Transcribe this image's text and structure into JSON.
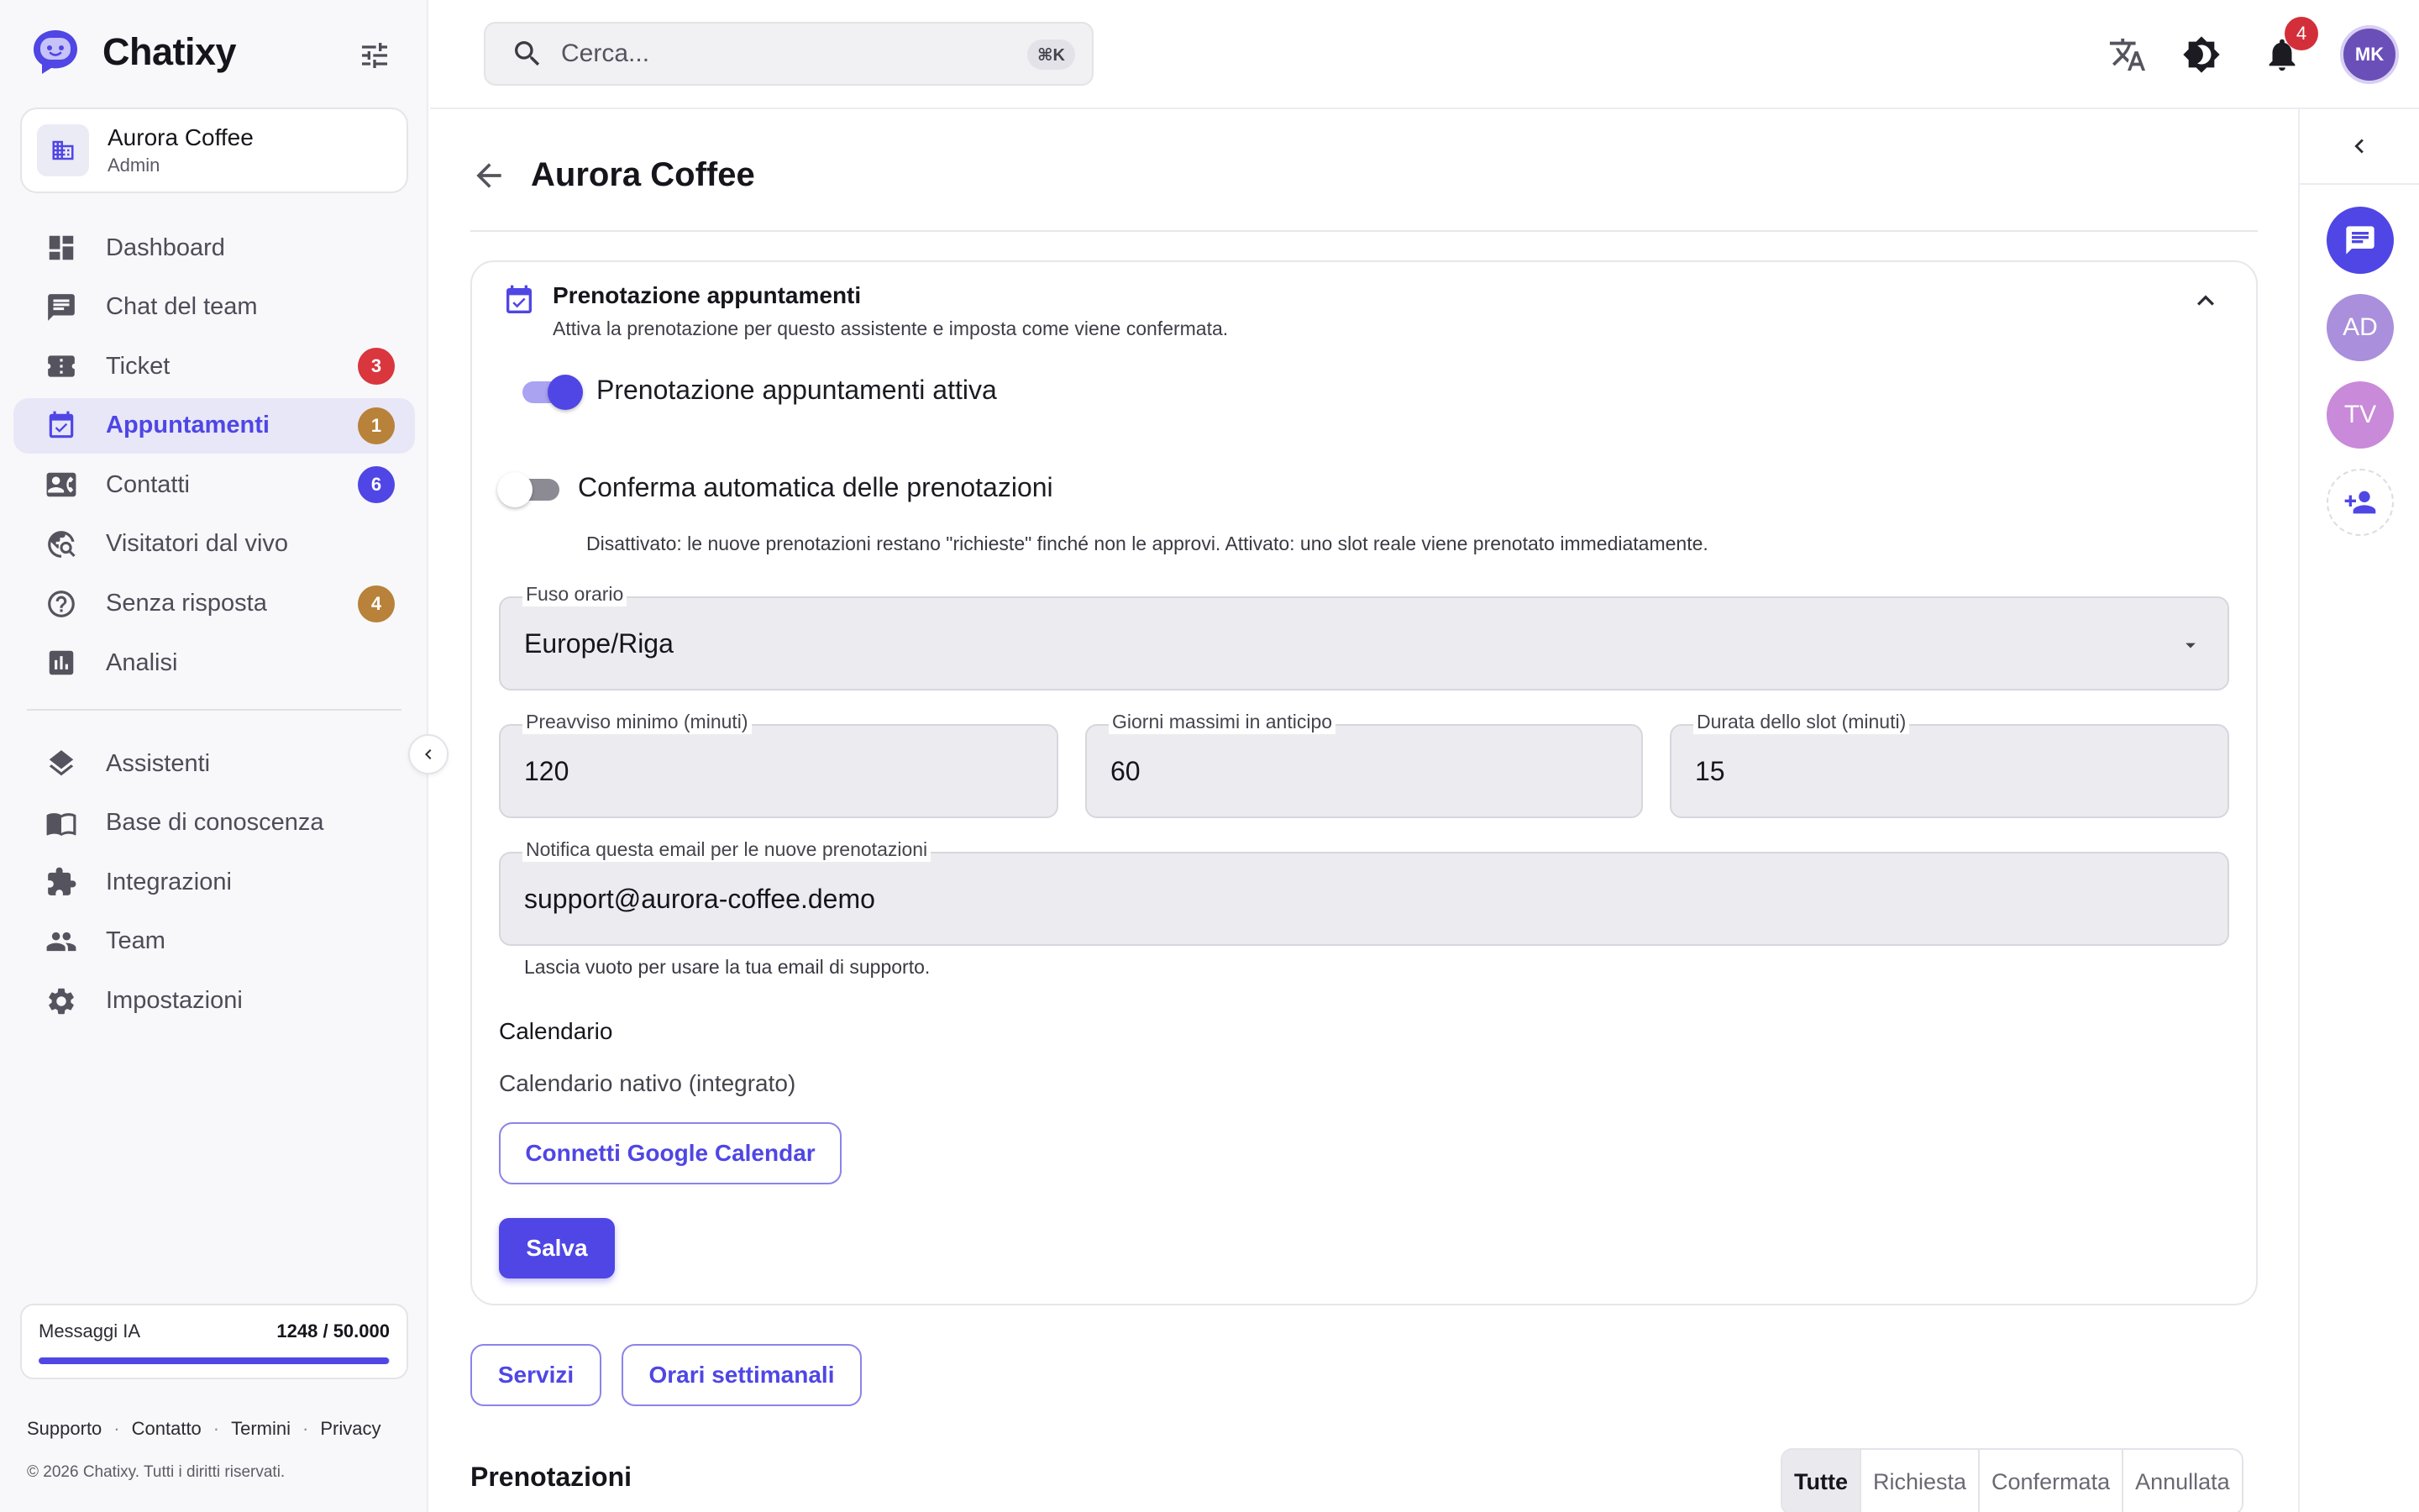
{
  "app": {
    "name": "Chatixy"
  },
  "workspace": {
    "name": "Aurora Coffee",
    "role": "Admin"
  },
  "nav": {
    "main": [
      {
        "label": "Dashboard",
        "icon": "dashboard-icon"
      },
      {
        "label": "Chat del team",
        "icon": "chat-icon"
      },
      {
        "label": "Ticket",
        "icon": "ticket-icon",
        "badge": "3",
        "badge_color": "#d9363e"
      },
      {
        "label": "Appuntamenti",
        "icon": "calendar-check-icon",
        "badge": "1",
        "badge_color": "#b8823a",
        "active": true
      },
      {
        "label": "Contatti",
        "icon": "contact-card-icon",
        "badge": "6",
        "badge_color": "#4f46e5"
      },
      {
        "label": "Visitatori dal vivo",
        "icon": "live-visitors-icon"
      },
      {
        "label": "Senza risposta",
        "icon": "help-circle-icon",
        "badge": "4",
        "badge_color": "#b8823a"
      },
      {
        "label": "Analisi",
        "icon": "analytics-icon"
      }
    ],
    "secondary": [
      {
        "label": "Assistenti",
        "icon": "layers-icon"
      },
      {
        "label": "Base di conoscenza",
        "icon": "book-icon"
      },
      {
        "label": "Integrazioni",
        "icon": "puzzle-icon"
      },
      {
        "label": "Team",
        "icon": "team-icon"
      },
      {
        "label": "Impostazioni",
        "icon": "gear-icon"
      }
    ]
  },
  "usage": {
    "label": "Messaggi IA",
    "value": "1248 / 50.000",
    "fraction": 0.9975
  },
  "footer": {
    "links": [
      "Supporto",
      "Contatto",
      "Termini",
      "Privacy"
    ],
    "copyright": "© 2026 Chatixy. Tutti i diritti riservati."
  },
  "topbar": {
    "search_placeholder": "Cerca...",
    "search_shortcut": "⌘K",
    "notifications_count": "4",
    "user_initials": "MK"
  },
  "rail": {
    "items": [
      {
        "type": "icon",
        "icon": "chat-bubble-icon",
        "color": "#4f46e5"
      },
      {
        "type": "avatar",
        "initials": "AD",
        "color": "#a98fdc"
      },
      {
        "type": "avatar",
        "initials": "TV",
        "color": "#c98ad9"
      },
      {
        "type": "icon",
        "icon": "add-person-icon"
      }
    ]
  },
  "page": {
    "title": "Aurora Coffee"
  },
  "booking": {
    "title": "Prenotazione appuntamenti",
    "subtitle": "Attiva la prenotazione per questo assistente e imposta come viene confermata.",
    "enable_label": "Prenotazione appuntamenti attiva",
    "enable_on": true,
    "auto_confirm_label": "Conferma automatica delle prenotazioni",
    "auto_confirm_on": false,
    "auto_confirm_hint": "Disattivato: le nuove prenotazioni restano \"richieste\" finché non le approvi. Attivato: uno slot reale viene prenotato immediatamente.",
    "timezone": {
      "label": "Fuso orario",
      "value": "Europe/Riga"
    },
    "min_notice": {
      "label": "Preavviso minimo (minuti)",
      "value": "120"
    },
    "max_days": {
      "label": "Giorni massimi in anticipo",
      "value": "60"
    },
    "slot_duration": {
      "label": "Durata dello slot (minuti)",
      "value": "15"
    },
    "notify_email": {
      "label": "Notifica questa email per le nuove prenotazioni",
      "value": "support@aurora-coffee.demo",
      "help": "Lascia vuoto per usare la tua email di supporto."
    },
    "calendar": {
      "title": "Calendario",
      "current": "Calendario nativo (integrato)",
      "connect_label": "Connetti Google Calendar"
    },
    "save_label": "Salva"
  },
  "actions": {
    "services_label": "Servizi",
    "weekly_hours_label": "Orari settimanali"
  },
  "bookings": {
    "title": "Prenotazioni",
    "filters": [
      "Tutte",
      "Richiesta",
      "Confermata",
      "Annullata"
    ],
    "active_filter": "Tutte"
  },
  "colors": {
    "accent": "#4f46e5",
    "badge_red": "#d9363e",
    "badge_amber": "#b8823a"
  }
}
